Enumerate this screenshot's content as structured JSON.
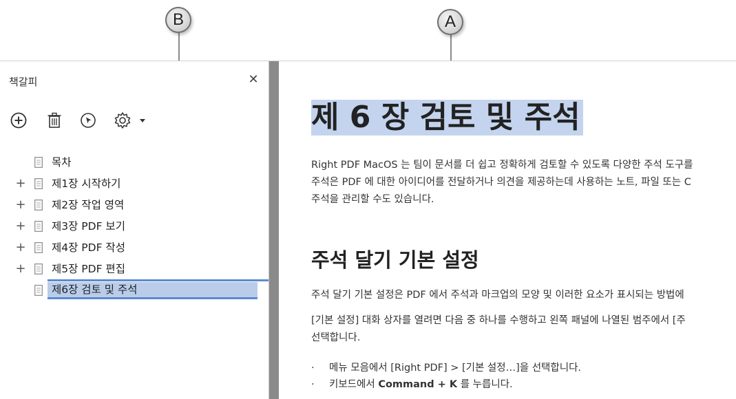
{
  "callouts": {
    "a": "A",
    "b": "B"
  },
  "sidebar": {
    "title": "책갈피",
    "close_icon": "close-icon",
    "toolbar": [
      {
        "icon": "add-icon"
      },
      {
        "icon": "trash-icon"
      },
      {
        "icon": "cursor-circle-icon"
      },
      {
        "icon": "gear-icon"
      }
    ],
    "items": [
      {
        "label": "목차",
        "expandable": false
      },
      {
        "label": "제1장 시작하기",
        "expandable": true
      },
      {
        "label": "제2장 작업 영역",
        "expandable": true
      },
      {
        "label": "제3장 PDF 보기",
        "expandable": true
      },
      {
        "label": "제4장 PDF 작성",
        "expandable": true
      },
      {
        "label": "제5장 PDF 편집",
        "expandable": true
      },
      {
        "label": "제6장  검토 및 주석",
        "expandable": false,
        "selected": true
      }
    ],
    "plus_symbol": "+"
  },
  "document": {
    "title": "제 6 장 검토 및 주석",
    "intro": [
      "Right PDF MacOS 는 팀이 문서를 더 쉽고 정확하게 검토할 수 있도록 다양한 주석 도구를",
      "주석은 PDF 에 대한 아이디어를 전달하거나 의견을 제공하는데 사용하는 노트, 파일 또는 C",
      "주석을 관리할 수도 있습니다."
    ],
    "section_title": "주석 달기 기본 설정",
    "section_para1": "주석 달기 기본 설정은 PDF 에서 주석과 마크업의 모양 및 이러한 요소가 표시되는 방법에",
    "section_para2": [
      "[기본 설정] 대화 상자를 열려면 다음 중 하나를 수행하고 왼쪽 패널에 나열된 범주에서 [주",
      "선택합니다."
    ],
    "bullets": [
      {
        "dot": "·",
        "pre": "메뉴 모음에서 [Right PDF] > [기본 설정…]을 선택합니다.",
        "bold": "",
        "post": ""
      },
      {
        "dot": "·",
        "pre": "키보드에서 ",
        "bold": "Command + K",
        "post": " 를 누릅니다."
      }
    ]
  }
}
